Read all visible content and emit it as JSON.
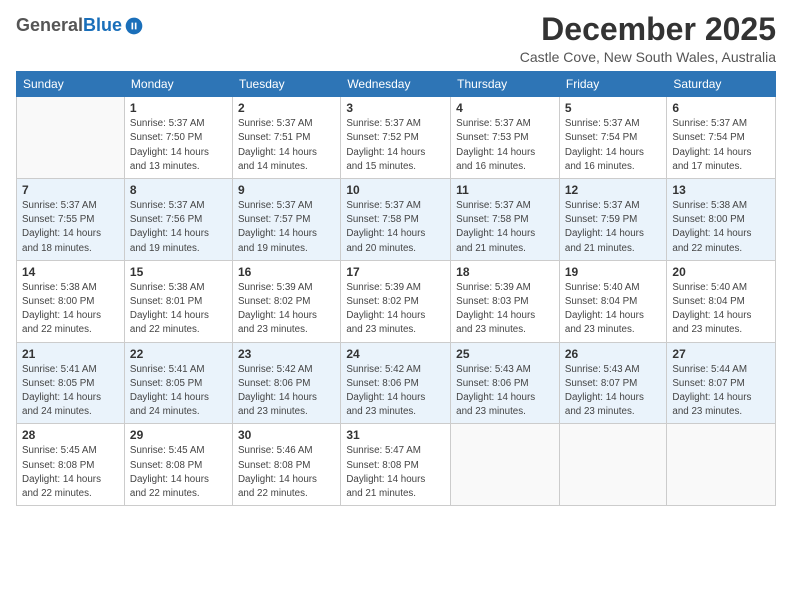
{
  "logo": {
    "general": "General",
    "blue": "Blue"
  },
  "title": "December 2025",
  "subtitle": "Castle Cove, New South Wales, Australia",
  "days_header": [
    "Sunday",
    "Monday",
    "Tuesday",
    "Wednesday",
    "Thursday",
    "Friday",
    "Saturday"
  ],
  "weeks": [
    [
      {
        "day": "",
        "info": ""
      },
      {
        "day": "1",
        "info": "Sunrise: 5:37 AM\nSunset: 7:50 PM\nDaylight: 14 hours\nand 13 minutes."
      },
      {
        "day": "2",
        "info": "Sunrise: 5:37 AM\nSunset: 7:51 PM\nDaylight: 14 hours\nand 14 minutes."
      },
      {
        "day": "3",
        "info": "Sunrise: 5:37 AM\nSunset: 7:52 PM\nDaylight: 14 hours\nand 15 minutes."
      },
      {
        "day": "4",
        "info": "Sunrise: 5:37 AM\nSunset: 7:53 PM\nDaylight: 14 hours\nand 16 minutes."
      },
      {
        "day": "5",
        "info": "Sunrise: 5:37 AM\nSunset: 7:54 PM\nDaylight: 14 hours\nand 16 minutes."
      },
      {
        "day": "6",
        "info": "Sunrise: 5:37 AM\nSunset: 7:54 PM\nDaylight: 14 hours\nand 17 minutes."
      }
    ],
    [
      {
        "day": "7",
        "info": "Sunrise: 5:37 AM\nSunset: 7:55 PM\nDaylight: 14 hours\nand 18 minutes."
      },
      {
        "day": "8",
        "info": "Sunrise: 5:37 AM\nSunset: 7:56 PM\nDaylight: 14 hours\nand 19 minutes."
      },
      {
        "day": "9",
        "info": "Sunrise: 5:37 AM\nSunset: 7:57 PM\nDaylight: 14 hours\nand 19 minutes."
      },
      {
        "day": "10",
        "info": "Sunrise: 5:37 AM\nSunset: 7:58 PM\nDaylight: 14 hours\nand 20 minutes."
      },
      {
        "day": "11",
        "info": "Sunrise: 5:37 AM\nSunset: 7:58 PM\nDaylight: 14 hours\nand 21 minutes."
      },
      {
        "day": "12",
        "info": "Sunrise: 5:37 AM\nSunset: 7:59 PM\nDaylight: 14 hours\nand 21 minutes."
      },
      {
        "day": "13",
        "info": "Sunrise: 5:38 AM\nSunset: 8:00 PM\nDaylight: 14 hours\nand 22 minutes."
      }
    ],
    [
      {
        "day": "14",
        "info": "Sunrise: 5:38 AM\nSunset: 8:00 PM\nDaylight: 14 hours\nand 22 minutes."
      },
      {
        "day": "15",
        "info": "Sunrise: 5:38 AM\nSunset: 8:01 PM\nDaylight: 14 hours\nand 22 minutes."
      },
      {
        "day": "16",
        "info": "Sunrise: 5:39 AM\nSunset: 8:02 PM\nDaylight: 14 hours\nand 23 minutes."
      },
      {
        "day": "17",
        "info": "Sunrise: 5:39 AM\nSunset: 8:02 PM\nDaylight: 14 hours\nand 23 minutes."
      },
      {
        "day": "18",
        "info": "Sunrise: 5:39 AM\nSunset: 8:03 PM\nDaylight: 14 hours\nand 23 minutes."
      },
      {
        "day": "19",
        "info": "Sunrise: 5:40 AM\nSunset: 8:04 PM\nDaylight: 14 hours\nand 23 minutes."
      },
      {
        "day": "20",
        "info": "Sunrise: 5:40 AM\nSunset: 8:04 PM\nDaylight: 14 hours\nand 23 minutes."
      }
    ],
    [
      {
        "day": "21",
        "info": "Sunrise: 5:41 AM\nSunset: 8:05 PM\nDaylight: 14 hours\nand 24 minutes."
      },
      {
        "day": "22",
        "info": "Sunrise: 5:41 AM\nSunset: 8:05 PM\nDaylight: 14 hours\nand 24 minutes."
      },
      {
        "day": "23",
        "info": "Sunrise: 5:42 AM\nSunset: 8:06 PM\nDaylight: 14 hours\nand 23 minutes."
      },
      {
        "day": "24",
        "info": "Sunrise: 5:42 AM\nSunset: 8:06 PM\nDaylight: 14 hours\nand 23 minutes."
      },
      {
        "day": "25",
        "info": "Sunrise: 5:43 AM\nSunset: 8:06 PM\nDaylight: 14 hours\nand 23 minutes."
      },
      {
        "day": "26",
        "info": "Sunrise: 5:43 AM\nSunset: 8:07 PM\nDaylight: 14 hours\nand 23 minutes."
      },
      {
        "day": "27",
        "info": "Sunrise: 5:44 AM\nSunset: 8:07 PM\nDaylight: 14 hours\nand 23 minutes."
      }
    ],
    [
      {
        "day": "28",
        "info": "Sunrise: 5:45 AM\nSunset: 8:08 PM\nDaylight: 14 hours\nand 22 minutes."
      },
      {
        "day": "29",
        "info": "Sunrise: 5:45 AM\nSunset: 8:08 PM\nDaylight: 14 hours\nand 22 minutes."
      },
      {
        "day": "30",
        "info": "Sunrise: 5:46 AM\nSunset: 8:08 PM\nDaylight: 14 hours\nand 22 minutes."
      },
      {
        "day": "31",
        "info": "Sunrise: 5:47 AM\nSunset: 8:08 PM\nDaylight: 14 hours\nand 21 minutes."
      },
      {
        "day": "",
        "info": ""
      },
      {
        "day": "",
        "info": ""
      },
      {
        "day": "",
        "info": ""
      }
    ]
  ]
}
